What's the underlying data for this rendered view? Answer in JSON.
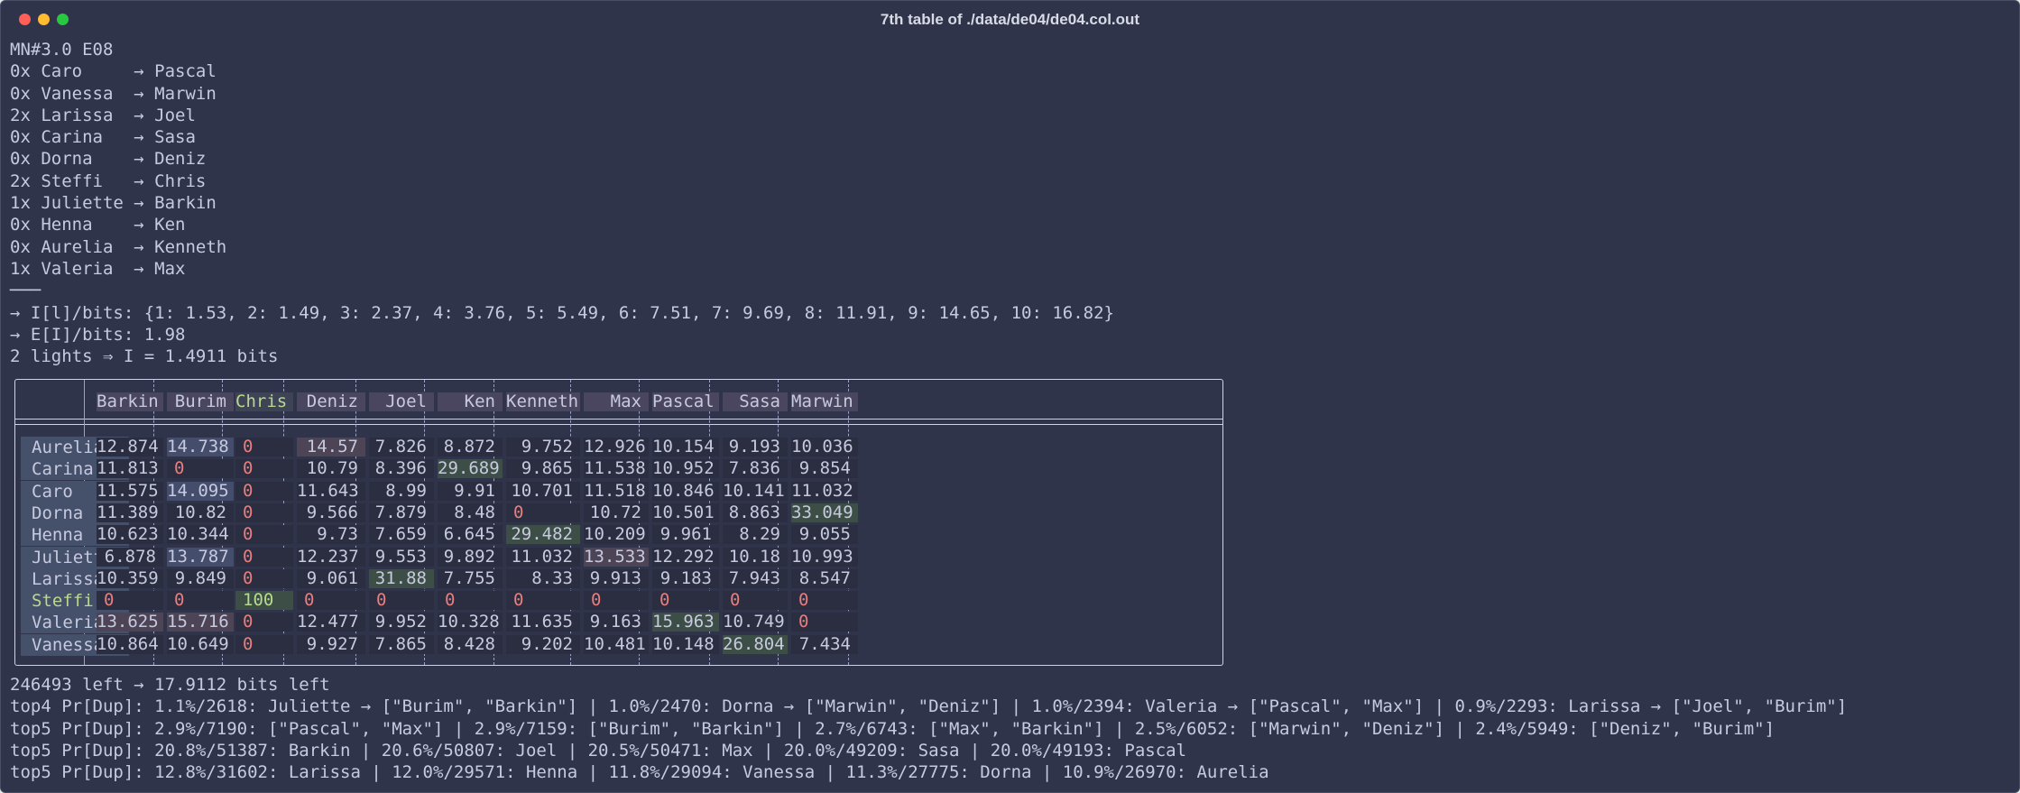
{
  "window": {
    "title": "7th table of ./data/de04/de04.col.out"
  },
  "header_lines": [
    "MN#3.0 E08",
    "0x Caro     → Pascal",
    "0x Vanessa  → Marwin",
    "2x Larissa  → Joel",
    "0x Carina   → Sasa",
    "0x Dorna    → Deniz",
    "2x Steffi   → Chris",
    "1x Juliette → Barkin",
    "0x Henna    → Ken",
    "0x Aurelia  → Kenneth",
    "1x Valeria  → Max",
    "───",
    "→ I[l]/bits: {1: 1.53, 2: 1.49, 3: 2.37, 4: 3.76, 5: 5.49, 6: 7.51, 7: 9.69, 8: 11.91, 9: 14.65, 10: 16.82}",
    "→ E[I]/bits: 1.98",
    "2 lights ⇒ I = 1.4911 bits"
  ],
  "table": {
    "columns": [
      "Barkin",
      "Burim",
      "Chris",
      "Deniz",
      "Joel",
      "Ken",
      "Kenneth",
      "Max",
      "Pascal",
      "Sasa",
      "Marwin"
    ],
    "rows": [
      {
        "name": "Aurelia",
        "cells": [
          "12.874",
          "14.738",
          "0",
          "14.57",
          "7.826",
          "8.872",
          "9.752",
          "12.926",
          "10.154",
          "9.193",
          "10.036"
        ],
        "hl": [
          "",
          "blue",
          "",
          "pink",
          "",
          "",
          "",
          "",
          "",
          "",
          ""
        ]
      },
      {
        "name": "Carina",
        "cells": [
          "11.813",
          "0",
          "0",
          "10.79",
          "8.396",
          "29.689",
          "9.865",
          "11.538",
          "10.952",
          "7.836",
          "9.854"
        ],
        "hl": [
          "",
          "",
          "",
          "",
          "",
          "green",
          "",
          "",
          "",
          "",
          ""
        ]
      },
      {
        "name": "Caro",
        "cells": [
          "11.575",
          "14.095",
          "0",
          "11.643",
          "8.99",
          "9.91",
          "10.701",
          "11.518",
          "10.846",
          "10.141",
          "11.032"
        ],
        "hl": [
          "",
          "blue",
          "",
          "",
          "",
          "",
          "",
          "",
          "",
          "",
          ""
        ]
      },
      {
        "name": "Dorna",
        "cells": [
          "11.389",
          "10.82",
          "0",
          "9.566",
          "7.879",
          "8.48",
          "0",
          "10.72",
          "10.501",
          "8.863",
          "33.049"
        ],
        "hl": [
          "",
          "",
          "",
          "",
          "",
          "",
          "",
          "",
          "",
          "",
          "green"
        ]
      },
      {
        "name": "Henna",
        "cells": [
          "10.623",
          "10.344",
          "0",
          "9.73",
          "7.659",
          "6.645",
          "29.482",
          "10.209",
          "9.961",
          "8.29",
          "9.055"
        ],
        "hl": [
          "",
          "",
          "",
          "",
          "",
          "",
          "green",
          "",
          "",
          "",
          ""
        ]
      },
      {
        "name": "Juliette",
        "cells": [
          "6.878",
          "13.787",
          "0",
          "12.237",
          "9.553",
          "9.892",
          "11.032",
          "13.533",
          "12.292",
          "10.18",
          "10.993"
        ],
        "hl": [
          "",
          "blue",
          "",
          "",
          "",
          "",
          "",
          "pink",
          "",
          "",
          ""
        ]
      },
      {
        "name": "Larissa",
        "cells": [
          "10.359",
          "9.849",
          "0",
          "9.061",
          "31.88",
          "7.755",
          "8.33",
          "9.913",
          "9.183",
          "7.943",
          "8.547"
        ],
        "hl": [
          "",
          "",
          "",
          "",
          "green",
          "",
          "",
          "",
          "",
          "",
          ""
        ]
      },
      {
        "name": "Steffi",
        "cells": [
          "0",
          "0",
          "100",
          "0",
          "0",
          "0",
          "0",
          "0",
          "0",
          "0",
          "0"
        ],
        "hl": [
          "",
          "",
          "",
          "",
          "",
          "",
          "",
          "",
          "",
          "",
          ""
        ]
      },
      {
        "name": "Valeria",
        "cells": [
          "13.625",
          "15.716",
          "0",
          "12.477",
          "9.952",
          "10.328",
          "11.635",
          "9.163",
          "15.963",
          "10.749",
          "0"
        ],
        "hl": [
          "pink",
          "pink",
          "",
          "",
          "",
          "",
          "",
          "",
          "green",
          "",
          ""
        ]
      },
      {
        "name": "Vanessa",
        "cells": [
          "10.864",
          "10.649",
          "0",
          "9.927",
          "7.865",
          "8.428",
          "9.202",
          "10.481",
          "10.148",
          "26.804",
          "7.434"
        ],
        "hl": [
          "",
          "",
          "",
          "",
          "",
          "",
          "",
          "",
          "",
          "green",
          ""
        ]
      }
    ]
  },
  "footer_lines": [
    "246493 left → 17.9112 bits left",
    "top4 Pr[Dup]: 1.1%/2618: Juliette → [\"Burim\", \"Barkin\"] | 1.0%/2470: Dorna → [\"Marwin\", \"Deniz\"] | 1.0%/2394: Valeria → [\"Pascal\", \"Max\"] | 0.9%/2293: Larissa → [\"Joel\", \"Burim\"]",
    "top5 Pr[Dup]: 2.9%/7190: [\"Pascal\", \"Max\"] | 2.9%/7159: [\"Burim\", \"Barkin\"] | 2.7%/6743: [\"Max\", \"Barkin\"] | 2.5%/6052: [\"Marwin\", \"Deniz\"] | 2.4%/5949: [\"Deniz\", \"Burim\"]",
    "top5 Pr[Dup]: 20.8%/51387: Barkin | 20.6%/50807: Joel | 20.5%/50471: Max | 20.0%/49209: Sasa | 20.0%/49193: Pascal",
    "top5 Pr[Dup]: 12.8%/31602: Larissa | 12.0%/29571: Henna | 11.8%/29094: Vanessa | 11.3%/27775: Dorna | 10.9%/26970: Aurelia"
  ]
}
